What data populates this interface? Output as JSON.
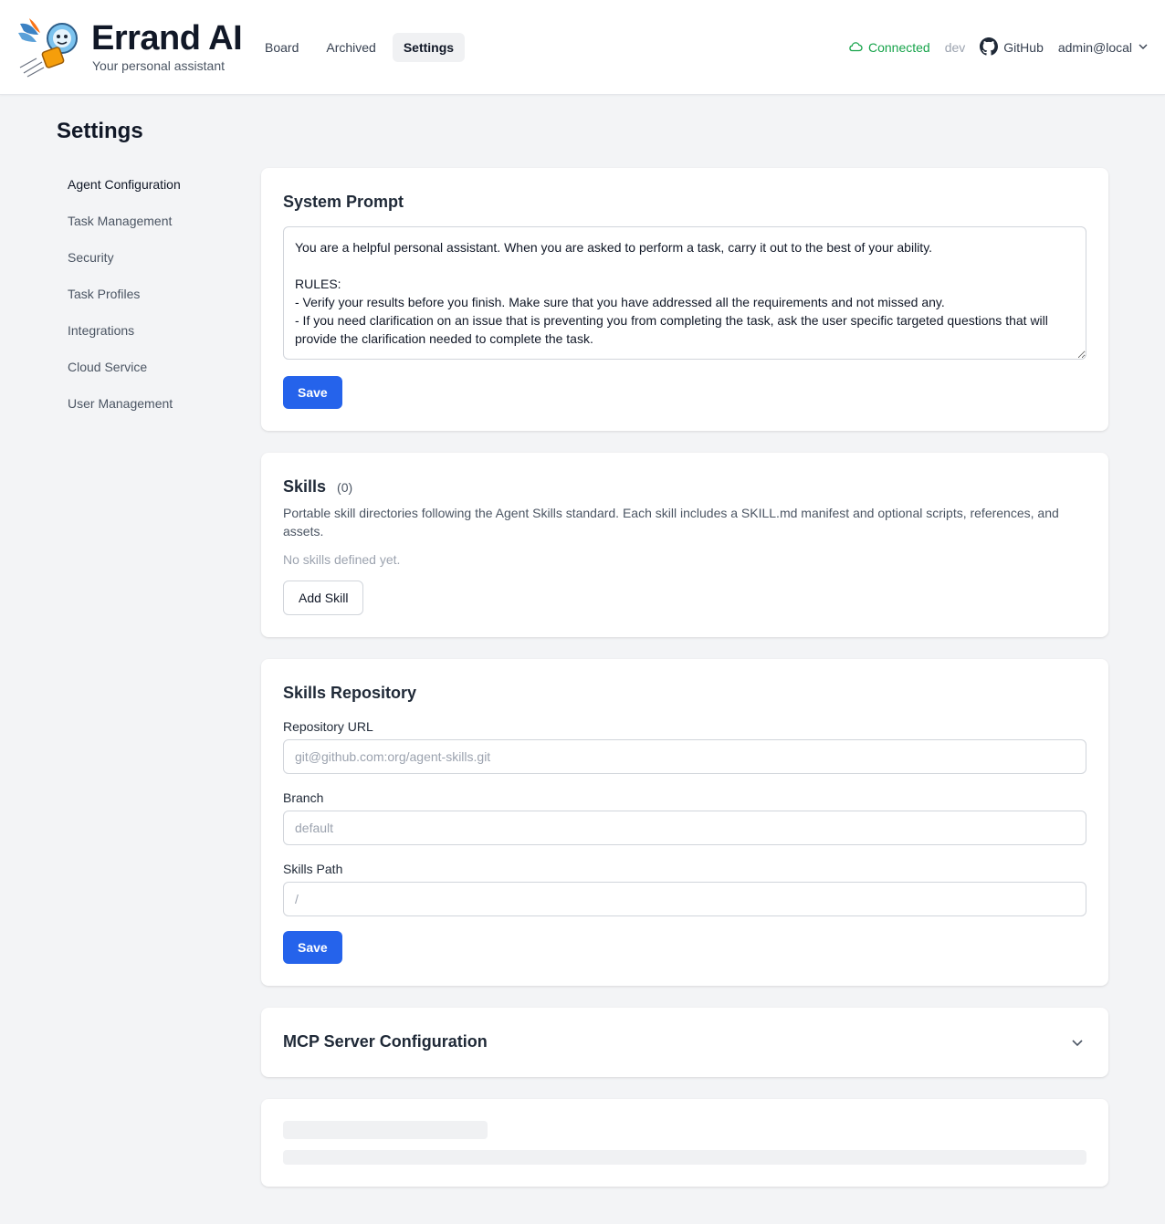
{
  "header": {
    "brand_name": "Errand AI",
    "tagline": "Your personal assistant",
    "nav": [
      {
        "label": "Board"
      },
      {
        "label": "Archived"
      },
      {
        "label": "Settings",
        "active": true
      }
    ],
    "status": "Connected",
    "env": "dev",
    "github": "GitHub",
    "user": "admin@local"
  },
  "page": {
    "title": "Settings"
  },
  "sidenav": {
    "items": [
      {
        "label": "Agent Configuration",
        "active": true
      },
      {
        "label": "Task Management"
      },
      {
        "label": "Security"
      },
      {
        "label": "Task Profiles"
      },
      {
        "label": "Integrations"
      },
      {
        "label": "Cloud Service"
      },
      {
        "label": "User Management"
      }
    ]
  },
  "system_prompt": {
    "title": "System Prompt",
    "value": "You are a helpful personal assistant. When you are asked to perform a task, carry it out to the best of your ability.\n\nRULES:\n- Verify your results before you finish. Make sure that you have addressed all the requirements and not missed any.\n- If you need clarification on an issue that is preventing you from completing the task, ask the user specific targeted questions that will provide the clarification needed to complete the task.",
    "save_label": "Save"
  },
  "skills": {
    "title": "Skills",
    "count": "(0)",
    "description": "Portable skill directories following the Agent Skills standard. Each skill includes a SKILL.md manifest and optional scripts, references, and assets.",
    "empty": "No skills defined yet.",
    "add_label": "Add Skill"
  },
  "skills_repo": {
    "title": "Skills Repository",
    "url_label": "Repository URL",
    "url_placeholder": "git@github.com:org/agent-skills.git",
    "branch_label": "Branch",
    "branch_placeholder": "default",
    "path_label": "Skills Path",
    "path_placeholder": "/",
    "save_label": "Save"
  },
  "mcp": {
    "title": "MCP Server Configuration"
  },
  "colors": {
    "accent": "#2563eb",
    "connected": "#16a34a",
    "background": "#f3f4f6"
  }
}
